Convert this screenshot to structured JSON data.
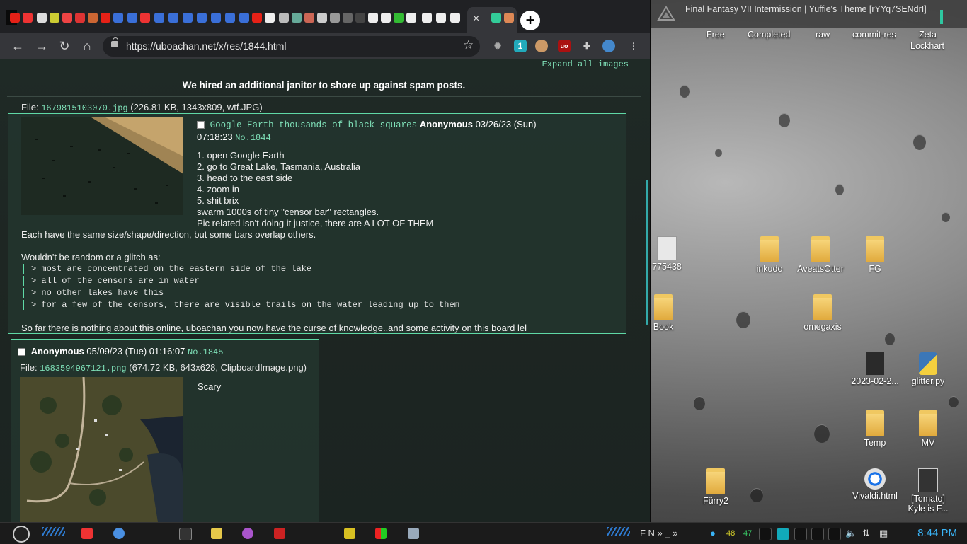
{
  "media": {
    "title": "Final Fantasy VII Intermission  |  Yuffie's Theme [rYYq7SENdrI]"
  },
  "bookmarks": [
    "Free",
    "Completed",
    "raw",
    "commit-res",
    "Zeta",
    "Lockhart"
  ],
  "desktop_icons": [
    {
      "label": "775438"
    },
    {
      "label": "inkudo"
    },
    {
      "label": "AveatsOtter"
    },
    {
      "label": "FG"
    },
    {
      "label": "Book"
    },
    {
      "label": "omegaxis"
    },
    {
      "label": "2023-02-2..."
    },
    {
      "label": "glitter.py"
    },
    {
      "label": "Temp"
    },
    {
      "label": "MV"
    },
    {
      "label": "Fürry2"
    },
    {
      "label": "Vivaldi.html"
    },
    {
      "label": "[Tomato]"
    },
    {
      "label": "Kyle is F..."
    }
  ],
  "browser": {
    "tab_close": "×",
    "newtab": "+",
    "url": "https://uboachan.net/x/res/1844.html",
    "ext_badge": "1"
  },
  "page": {
    "expand_all": "Expand all images",
    "banner": "We hired an additional janitor to shore up against spam posts."
  },
  "op": {
    "file_label": "File:",
    "file_link": "1679815103070.jpg",
    "file_meta": "(226.81 KB, 1343x809, wtf.JPG)",
    "subject": "Google Earth thousands of black squares",
    "name": "Anonymous",
    "date": "03/26/23 (Sun)",
    "time": "07:18:23",
    "no": "No.1844",
    "lines": [
      "1. open Google Earth",
      "2. go to Great Lake, Tasmania, Australia",
      "3. head to the east side",
      "4. zoom in",
      "5. shit brix",
      "swarm 1000s of tiny \"censor bar\" rectangles.",
      "Pic related isn't doing it justice, there are A LOT OF THEM"
    ],
    "line_full": "Each have the same size/shape/direction, but some bars overlap others.",
    "line_random": "Wouldn't be random or a glitch as:",
    "quotes": [
      "> most are concentrated on the eastern side of the lake",
      "> all of the censors are in water",
      "> no other lakes have this",
      "> for a few of the censors, there are visible trails on the water leading up to them"
    ],
    "closing": "So far there is nothing about this online, uboachan you now have the curse of knowledge..and some activity on this board lel"
  },
  "reply": {
    "name": "Anonymous",
    "date": "05/09/23 (Tue) 01:16:07",
    "no": "No.1845",
    "file_label": "File:",
    "file_link": "1683594967121.png",
    "file_meta": "(674.72 KB, 643x628, ClipboardImage.png)",
    "body": "Scary"
  },
  "taskbar": {
    "tray_letters": "F  N  »  _  »",
    "cpu1": "48",
    "cpu2": "47",
    "clock": "8:44 PM"
  }
}
